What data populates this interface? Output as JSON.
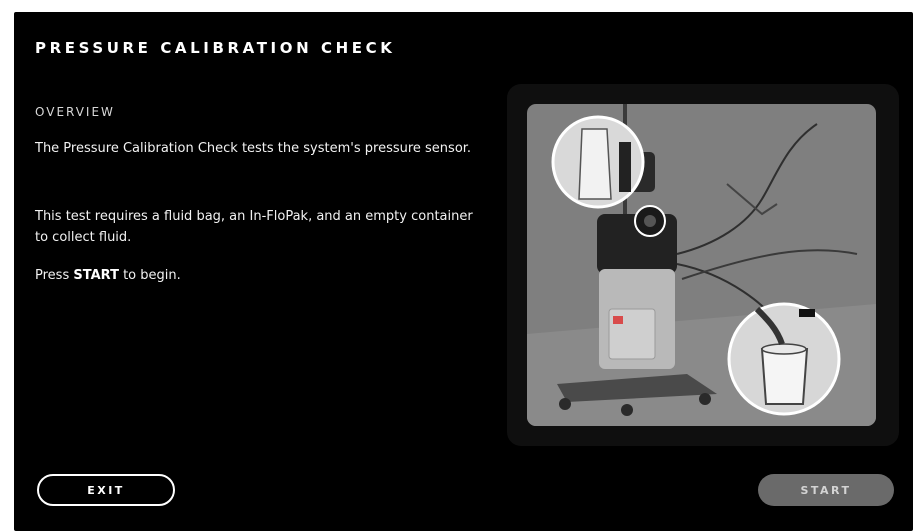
{
  "screen": {
    "title": "PRESSURE CALIBRATION CHECK",
    "background_color": "#000000"
  },
  "overview": {
    "heading": "OVERVIEW",
    "paragraph_1": "The Pressure Calibration Check tests the system's pressure sensor.",
    "paragraph_2": "This test requires a fluid bag, an In-FloPak, and an empty container to collect fluid.",
    "paragraph_3_prefix": "Press ",
    "paragraph_3_bold": "START",
    "paragraph_3_suffix": " to begin."
  },
  "illustration": {
    "subject": "fluid-management-system-setup-illustration",
    "callouts": [
      "fluid-bag-callout",
      "connector-callout",
      "container-callout"
    ]
  },
  "buttons": {
    "exit_label": "EXIT",
    "start_label": "START",
    "start_state": "disabled-appearance"
  },
  "colors": {
    "text": "#ffffff",
    "start_button_bg": "#6a6a6a",
    "illustration_bg": "#7f7f7f"
  }
}
